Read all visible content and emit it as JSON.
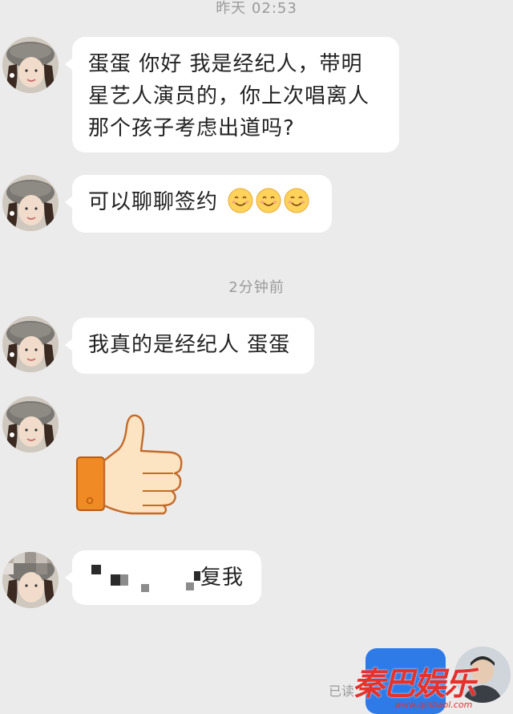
{
  "timestamps": {
    "yesterday": "昨天 02:53",
    "recent": "2分钟前"
  },
  "messages": {
    "m1": "蛋蛋 你好 我是经纪人，带明星艺人演员的，你上次唱离人那个孩子考虑出道吗?",
    "m2": "可以聊聊签约",
    "m3": "我真的是经纪人 蛋蛋",
    "m4_thumb": "thumbs-up-sticker",
    "m5": "复我"
  },
  "self": {
    "read_label": "已读"
  },
  "watermark": {
    "logo": "秦巴娱乐",
    "url": "www.qinbaol.com"
  },
  "colors": {
    "background": "#ebebeb",
    "bubble": "#ffffff",
    "self_bubble": "#2e7be8",
    "watermark": "#e5322d"
  }
}
